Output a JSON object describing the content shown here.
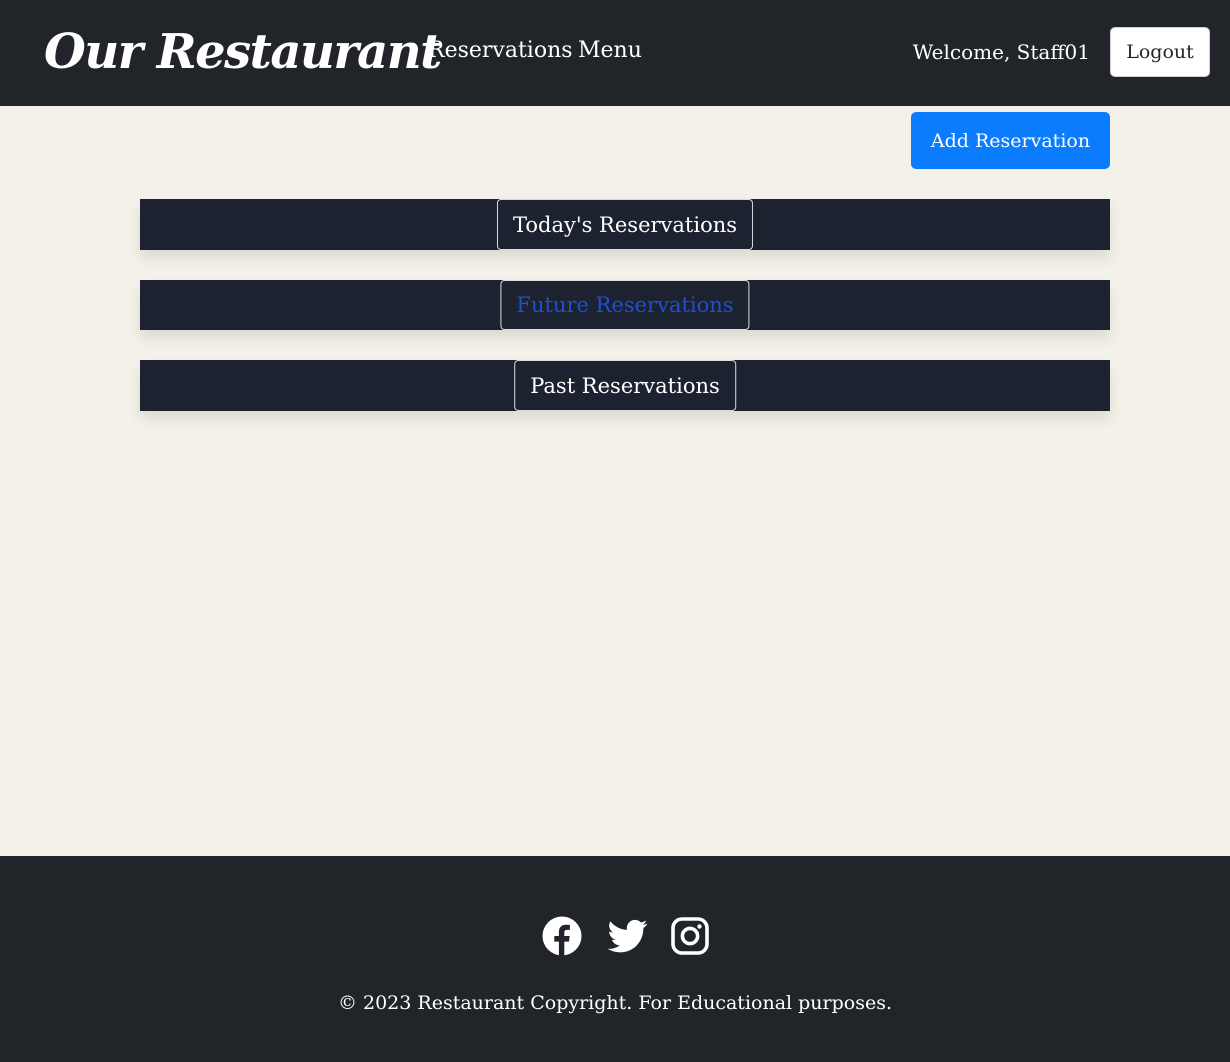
{
  "navbar": {
    "brand": "Our Restaurant",
    "links": [
      "Reservations",
      "Menu"
    ],
    "welcome": "Welcome, Staff01",
    "logout_label": "Logout"
  },
  "actions": {
    "add_reservation_label": "Add Reservation"
  },
  "sections": [
    {
      "label": "Today's Reservations"
    },
    {
      "label": "Future Reservations"
    },
    {
      "label": "Past Reservations"
    }
  ],
  "footer": {
    "social": [
      "facebook-icon",
      "twitter-icon",
      "instagram-icon"
    ],
    "copyright": "© 2023 Restaurant Copyright. For Educational purposes."
  },
  "colors": {
    "navbar_bg": "#212429",
    "page_bg": "#f4f1e9",
    "primary_button": "#0a7cfd",
    "section_bar": "#1c2230",
    "active_section_text": "#1f4fd1"
  }
}
